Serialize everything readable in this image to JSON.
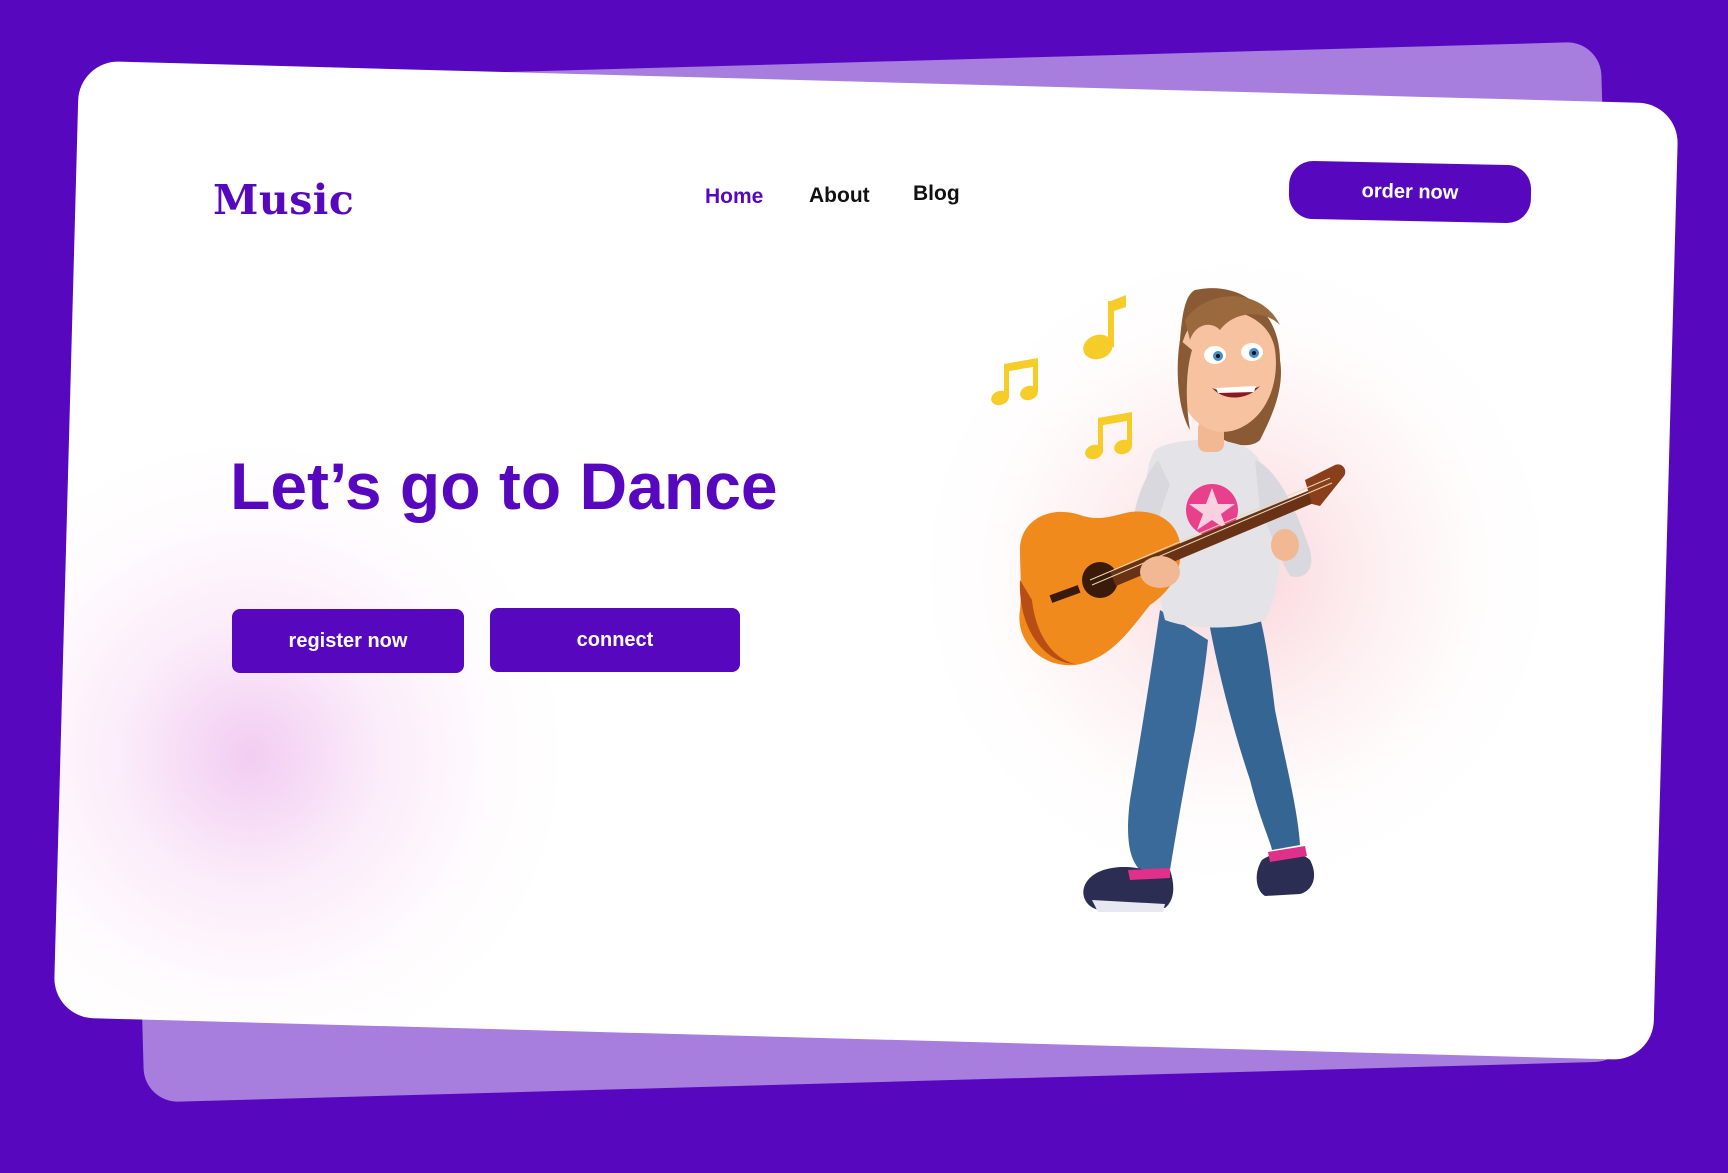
{
  "brand": {
    "logo_text": "Music"
  },
  "nav": {
    "items": [
      {
        "label": "Home",
        "active": true
      },
      {
        "label": "About",
        "active": false
      },
      {
        "label": "Blog",
        "active": false
      }
    ]
  },
  "header": {
    "order_label": "order now"
  },
  "hero": {
    "headline": "Let’s go to Dance",
    "register_label": "register now",
    "connect_label": "connect"
  },
  "illustration": {
    "subject": "girl-with-guitar",
    "notes_icon": "music-notes-icon"
  },
  "colors": {
    "page_background": "#5708be",
    "back_card": "#a77ede",
    "card": "#ffffff",
    "accent": "#5708be",
    "note": "#f5cc28",
    "guitar": "#f08a1c"
  }
}
